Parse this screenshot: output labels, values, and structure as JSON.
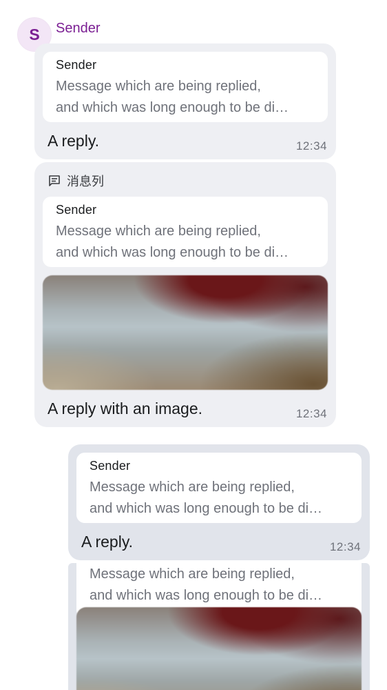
{
  "sender": {
    "initial": "S",
    "name": "Sender"
  },
  "messages": [
    {
      "quote": {
        "sender": "Sender",
        "line1": "Message which are being replied,",
        "line2": "and which was long enough to be di…"
      },
      "text": "A reply.",
      "time": "12:34"
    },
    {
      "thread_label": "消息列",
      "quote": {
        "sender": "Sender",
        "line1": "Message which are being replied,",
        "line2": "and which was long enough to be di…"
      },
      "text": "A reply with an image.",
      "time": "12:34"
    },
    {
      "quote": {
        "sender": "Sender",
        "line1": "Message which are being replied,",
        "line2": "and which was long enough to be di…"
      },
      "text": "A reply.",
      "time": "12:34"
    },
    {
      "quote": {
        "line1": "Message which are being replied,",
        "line2": "and which was long enough to be di…"
      }
    }
  ],
  "icons": {
    "thread": "thread-icon"
  }
}
